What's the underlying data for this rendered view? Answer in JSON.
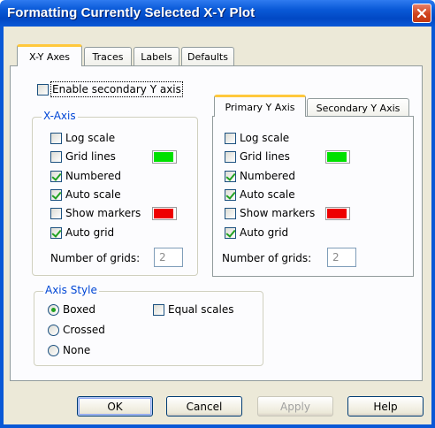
{
  "window": {
    "title": "Formatting Currently Selected X-Y Plot",
    "close_icon": "close-icon"
  },
  "tabs": [
    {
      "label": "X-Y Axes",
      "active": true
    },
    {
      "label": "Traces",
      "active": false
    },
    {
      "label": "Labels",
      "active": false
    },
    {
      "label": "Defaults",
      "active": false
    }
  ],
  "secondary_y": {
    "label": "Enable secondary Y axis",
    "checked": false
  },
  "x_axis": {
    "title": "X-Axis",
    "options": [
      {
        "label": "Log scale",
        "checked": false
      },
      {
        "label": "Grid lines",
        "checked": false,
        "color": "#00e000"
      },
      {
        "label": "Numbered",
        "checked": true
      },
      {
        "label": "Auto scale",
        "checked": true
      },
      {
        "label": "Show markers",
        "checked": false,
        "color": "#ee0000"
      },
      {
        "label": "Auto grid",
        "checked": true
      }
    ],
    "grids_label": "Number of grids:",
    "grids_value": "2"
  },
  "y_tabs": [
    {
      "label": "Primary Y Axis",
      "active": true
    },
    {
      "label": "Secondary Y Axis",
      "active": false
    }
  ],
  "y_axis": {
    "options": [
      {
        "label": "Log scale",
        "checked": false
      },
      {
        "label": "Grid lines",
        "checked": false,
        "color": "#00e000"
      },
      {
        "label": "Numbered",
        "checked": true
      },
      {
        "label": "Auto scale",
        "checked": true
      },
      {
        "label": "Show markers",
        "checked": false,
        "color": "#ee0000"
      },
      {
        "label": "Auto grid",
        "checked": true
      }
    ],
    "grids_label": "Number of grids:",
    "grids_value": "2"
  },
  "axis_style": {
    "title": "Axis Style",
    "options": [
      {
        "label": "Boxed",
        "selected": true
      },
      {
        "label": "Crossed",
        "selected": false
      },
      {
        "label": "None",
        "selected": false
      }
    ],
    "equal_scales": {
      "label": "Equal scales",
      "checked": false
    }
  },
  "buttons": {
    "ok": "OK",
    "cancel": "Cancel",
    "apply": "Apply",
    "help": "Help"
  }
}
